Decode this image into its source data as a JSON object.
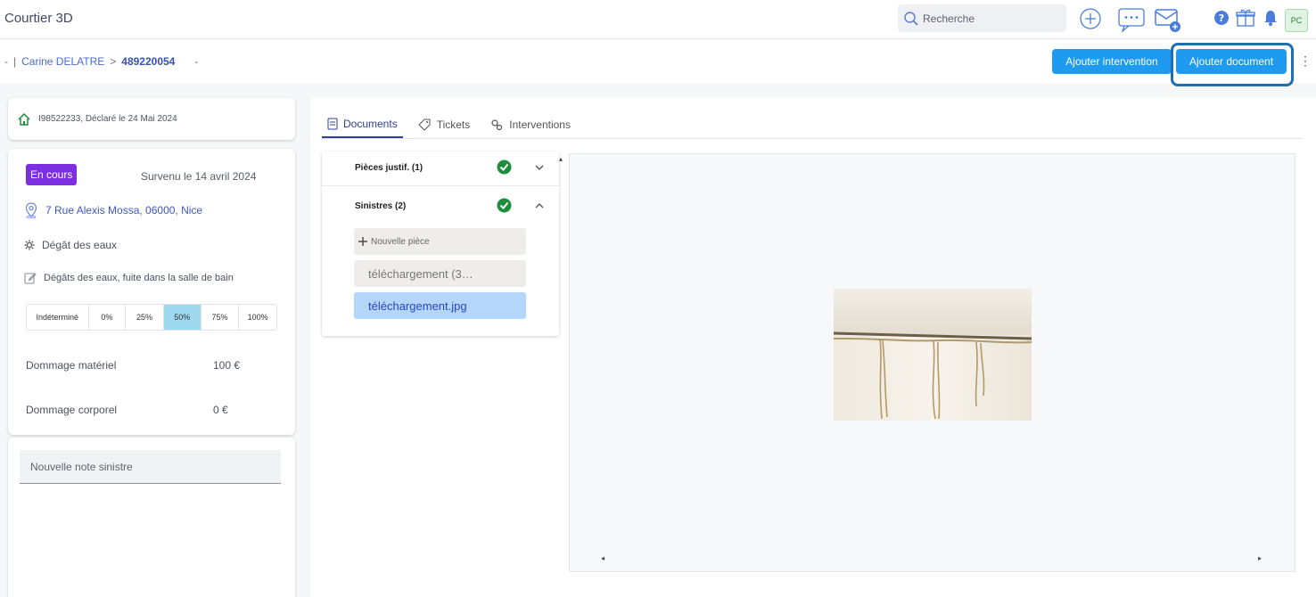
{
  "header": {
    "app_title": "Courtier 3D",
    "search_placeholder": "Recherche",
    "avatar_initials": "PC"
  },
  "breadcrumb": {
    "dash": "-",
    "sep": "|",
    "client": "Carine DELATRE",
    "arrow": ">",
    "policy_id": "489220054",
    "trailing": "-"
  },
  "actions": {
    "add_intervention": "Ajouter intervention",
    "add_document": "Ajouter document"
  },
  "claim_card": {
    "text": "I98522233, Déclaré le 24 Mai 2024"
  },
  "details": {
    "status": "En cours",
    "date": "Survenu le 14 avril 2024",
    "address": "7 Rue Alexis Mossa, 06000, Nice",
    "type": "Dégât des eaux",
    "description": "Dégâts des eaux, fuite dans la salle de bain",
    "progress_options": [
      "Indéterminé",
      "0%",
      "25%",
      "50%",
      "75%",
      "100%"
    ],
    "progress_selected": "50%",
    "material_label": "Dommage matériel",
    "material_value": "100 €",
    "bodily_label": "Dommage corporel",
    "bodily_value": "0 €"
  },
  "note": {
    "placeholder": "Nouvelle note sinistre"
  },
  "tabs": [
    "Documents",
    "Tickets",
    "Interventions"
  ],
  "documents": {
    "group1": "Pièces justif. (1)",
    "group2": "Sinistres (2)",
    "new_item": "Nouvelle pièce",
    "files": [
      "téléchargement (3…",
      "téléchargement.jpg"
    ],
    "selected_file": "téléchargement.jpg"
  },
  "colors": {
    "primary_button": "#1e9bf0",
    "status_badge": "#7b2fe0",
    "selected_progress": "#9fd9f0",
    "selected_file": "#b5d6fb",
    "check_green": "#1e8e3e"
  }
}
